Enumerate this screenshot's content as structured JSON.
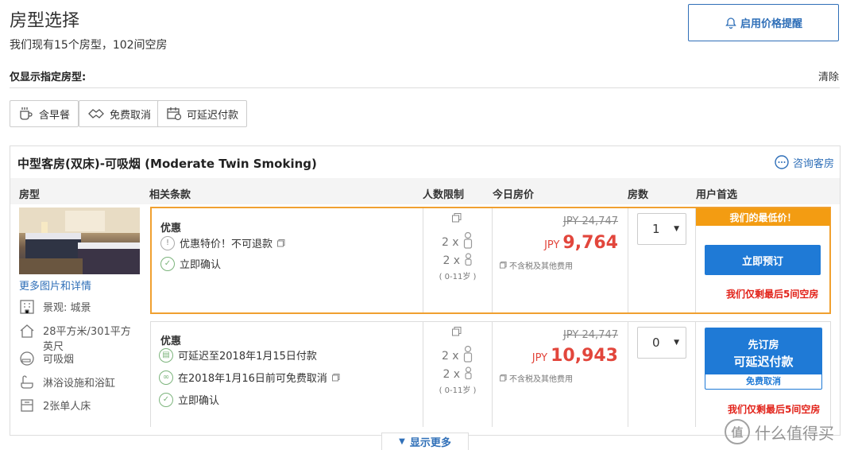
{
  "header": {
    "title": "房型选择",
    "subtitle": "我们现有15个房型，102间空房",
    "alert_button": "启用价格提醒"
  },
  "filters": {
    "label": "仅显示指定房型:",
    "clear": "清除",
    "chips": [
      "含早餐",
      "免费取消",
      "可延迟付款"
    ]
  },
  "room": {
    "name": "中型客房(双床)-可吸烟 (Moderate Twin Smoking)",
    "consult": "咨询客房",
    "more_photos": "更多图片和详情",
    "features": [
      "景观: 城景",
      "28平方米/301平方英尺",
      "可吸烟",
      "淋浴设施和浴缸",
      "2张单人床"
    ]
  },
  "columns": {
    "room_type": "房型",
    "terms": "相关条款",
    "occupancy": "人数限制",
    "price": "今日房价",
    "rooms": "房数",
    "choice": "用户首选"
  },
  "offers": [
    {
      "title": "优惠",
      "conditions": [
        "优惠特价！不可退款",
        "立即确认"
      ],
      "adults": "2 x",
      "children": "2 x",
      "children_age": "( 0-11岁 )",
      "old_price": "JPY 24,747",
      "currency": "JPY",
      "price": "9,764",
      "tax_note": "不含税及其他费用",
      "qty": "1",
      "badge": "我们的最低价！",
      "button": "立即预订",
      "warning": "我们仅剩最后5间空房"
    },
    {
      "title": "优惠",
      "conditions": [
        "可延迟至2018年1月15日付款",
        "在2018年1月16日前可免费取消",
        "立即确认"
      ],
      "adults": "2 x",
      "children": "2 x",
      "children_age": "( 0-11岁 )",
      "old_price": "JPY 24,747",
      "currency": "JPY",
      "price": "10,943",
      "tax_note": "不含税及其他费用",
      "qty": "0",
      "button_line1": "先订房",
      "button_line2": "可延迟付款",
      "button_sub": "免费取消",
      "warning": "我们仅剩最后5间空房"
    }
  ],
  "show_more": "显示更多",
  "watermark": "什么值得买",
  "watermark_badge": "值",
  "colors": {
    "accent_blue": "#1f7ad6",
    "price_red": "#e2463c",
    "highlight_orange": "#f39c12",
    "warning_red": "#e2231a"
  }
}
